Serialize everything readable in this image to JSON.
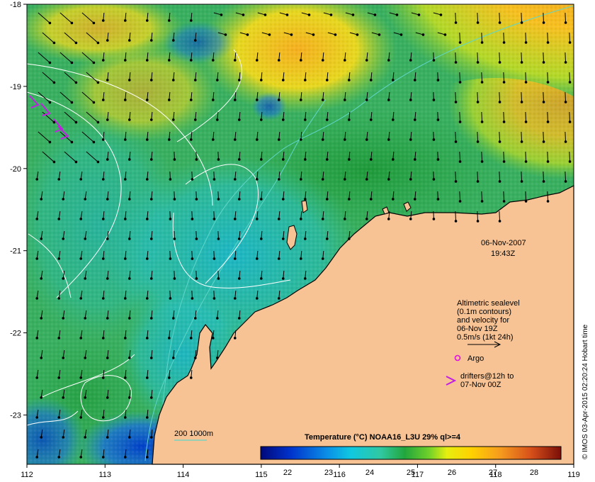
{
  "map": {
    "lon_ticks": [
      "112",
      "113",
      "114",
      "115",
      "116",
      "117",
      "118",
      "119"
    ],
    "lat_ticks": [
      "-18",
      "-19",
      "-20",
      "-21",
      "-22",
      "-23"
    ],
    "lon_range": [
      112,
      119
    ],
    "lat_range": [
      -23.6,
      -18
    ],
    "date": "06-Nov-2007",
    "time": "19:43Z",
    "legend_lines": [
      "Altimetric sealevel",
      "(0.1m contours)",
      "and velocity for",
      "06-Nov 19Z",
      "0.5m/s (1kt 24h)"
    ],
    "argo_label": "Argo",
    "drifters_line1": "drifters@12h to",
    "drifters_line2": "07-Nov 00Z",
    "bathy_label": "200  1000m",
    "colorbar_title": "Temperature (°C) NOAA16_L3U 29% ql>=4",
    "colorbar_ticks": [
      "22",
      "23",
      "24",
      "25",
      "26",
      "27",
      "28"
    ],
    "credit": "© IMOS 03-Apr-2015 02:20:24 Hobart time",
    "colors": {
      "land": "#f7c394",
      "contour": "#ffffff",
      "bathymetry": "#5fd6c8",
      "argo": "#e010e0",
      "drifter": "#c020e0",
      "arrow": "#000000"
    }
  }
}
